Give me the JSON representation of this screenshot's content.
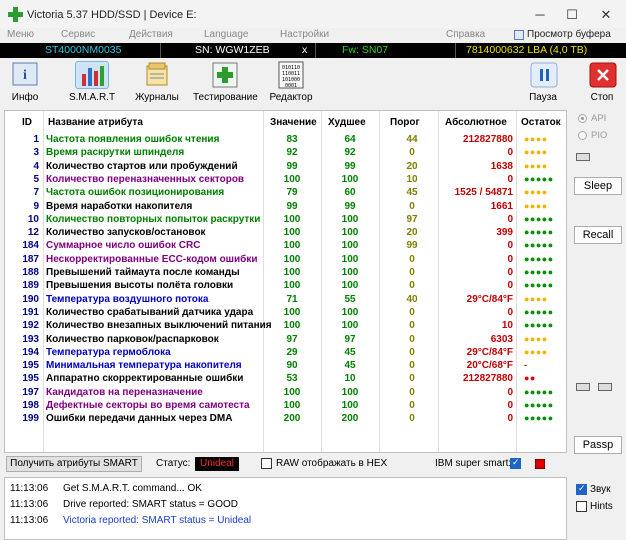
{
  "window": {
    "title": "Victoria 5.37 HDD/SSD | Device E:"
  },
  "menu": {
    "items": [
      "Меню",
      "Сервис",
      "Действия",
      "Language",
      "Настройки",
      "Справка"
    ],
    "preview_label": "Просмотр буфера"
  },
  "drive": {
    "model": "ST4000NM0035",
    "serial": "SN: WGW1ZEB",
    "close": "x",
    "firmware": "Fw: SN07",
    "capacity": "7814000632 LBA (4,0 TB)"
  },
  "toolbar": {
    "info": "Инфо",
    "smart": "S.M.A.R.T",
    "journals": "Журналы",
    "testing": "Тестирование",
    "editor": "Редактор",
    "pause": "Пауза",
    "stop": "Стоп"
  },
  "table": {
    "headers": [
      "ID",
      "Название атрибута",
      "Значение",
      "Худшее",
      "Порог",
      "Абсолютное",
      "Остаток"
    ],
    "rows": [
      {
        "id": "1",
        "name": "Частота появления ошибок чтения",
        "color": "#008000",
        "value": "83",
        "worst": "64",
        "threshold": "44",
        "raw": "212827880",
        "rest": "●●●●",
        "rest_color": "#f0b400"
      },
      {
        "id": "3",
        "name": "Время раскрутки шпинделя",
        "color": "#008000",
        "value": "92",
        "worst": "92",
        "threshold": "0",
        "raw": "0",
        "rest": "●●●●",
        "rest_color": "#f0b400"
      },
      {
        "id": "4",
        "name": "Количество стартов или пробуждений",
        "color": "#000000",
        "value": "99",
        "worst": "99",
        "threshold": "20",
        "raw": "1638",
        "rest": "●●●●",
        "rest_color": "#f0b400"
      },
      {
        "id": "5",
        "name": "Количество переназначенных секторов",
        "color": "#800080",
        "value": "100",
        "worst": "100",
        "threshold": "10",
        "raw": "0",
        "rest": "●●●●●",
        "rest_color": "#009000"
      },
      {
        "id": "7",
        "name": "Частота ошибок позиционирования",
        "color": "#008000",
        "value": "79",
        "worst": "60",
        "threshold": "45",
        "raw": "1525 / 54871",
        "rest": "●●●●",
        "rest_color": "#f0b400"
      },
      {
        "id": "9",
        "name": "Время наработки накопителя",
        "color": "#000000",
        "value": "99",
        "worst": "99",
        "threshold": "0",
        "raw": "1661",
        "rest": "●●●●",
        "rest_color": "#f0b400"
      },
      {
        "id": "10",
        "name": "Количество повторных попыток раскрутки",
        "color": "#008000",
        "value": "100",
        "worst": "100",
        "threshold": "97",
        "raw": "0",
        "rest": "●●●●●",
        "rest_color": "#009000"
      },
      {
        "id": "12",
        "name": "Количество запусков/остановок",
        "color": "#000000",
        "value": "100",
        "worst": "100",
        "threshold": "20",
        "raw": "399",
        "rest": "●●●●●",
        "rest_color": "#009000"
      },
      {
        "id": "184",
        "name": "Суммарное число ошибок CRC",
        "color": "#800080",
        "value": "100",
        "worst": "100",
        "threshold": "99",
        "raw": "0",
        "rest": "●●●●●",
        "rest_color": "#009000"
      },
      {
        "id": "187",
        "name": "Нескорректированные ECC-кодом ошибки",
        "color": "#800080",
        "value": "100",
        "worst": "100",
        "threshold": "0",
        "raw": "0",
        "rest": "●●●●●",
        "rest_color": "#009000"
      },
      {
        "id": "188",
        "name": "Превышений таймаута после команды",
        "color": "#000000",
        "value": "100",
        "worst": "100",
        "threshold": "0",
        "raw": "0",
        "rest": "●●●●●",
        "rest_color": "#009000"
      },
      {
        "id": "189",
        "name": "Превышения высоты полёта головки",
        "color": "#000000",
        "value": "100",
        "worst": "100",
        "threshold": "0",
        "raw": "0",
        "rest": "●●●●●",
        "rest_color": "#009000"
      },
      {
        "id": "190",
        "name": "Температура воздушного потока",
        "color": "#0000c0",
        "value": "71",
        "worst": "55",
        "threshold": "40",
        "raw": "29°C/84°F",
        "rest": "●●●●",
        "rest_color": "#f0b400"
      },
      {
        "id": "191",
        "name": "Количество срабатываний датчика удара",
        "color": "#000000",
        "value": "100",
        "worst": "100",
        "threshold": "0",
        "raw": "0",
        "rest": "●●●●●",
        "rest_color": "#009000"
      },
      {
        "id": "192",
        "name": "Количество внезапных выключений питания",
        "color": "#000000",
        "value": "100",
        "worst": "100",
        "threshold": "0",
        "raw": "10",
        "rest": "●●●●●",
        "rest_color": "#009000"
      },
      {
        "id": "193",
        "name": "Количество парковок/распарковок",
        "color": "#000000",
        "value": "97",
        "worst": "97",
        "threshold": "0",
        "raw": "6303",
        "rest": "●●●●",
        "rest_color": "#f0b400"
      },
      {
        "id": "194",
        "name": "Температура гермоблока",
        "color": "#0000c0",
        "value": "29",
        "worst": "45",
        "threshold": "0",
        "raw": "29°C/84°F",
        "rest": "●●●●",
        "rest_color": "#f0b400"
      },
      {
        "id": "195",
        "name": "Минимальная температура накопителя",
        "color": "#0000c0",
        "value": "90",
        "worst": "45",
        "threshold": "0",
        "raw": "20°C/68°F",
        "rest": "-",
        "rest_color": "#c00000"
      },
      {
        "id": "195",
        "name": "Аппаратно скорректированные ошибки",
        "color": "#000000",
        "value": "53",
        "worst": "10",
        "threshold": "0",
        "raw": "212827880",
        "rest": "●●",
        "rest_color": "#e00000"
      },
      {
        "id": "197",
        "name": "Кандидатов на переназначение",
        "color": "#800080",
        "value": "100",
        "worst": "100",
        "threshold": "0",
        "raw": "0",
        "rest": "●●●●●",
        "rest_color": "#009000"
      },
      {
        "id": "198",
        "name": "Дефектные секторы во время самотеста",
        "color": "#800080",
        "value": "100",
        "worst": "100",
        "threshold": "0",
        "raw": "0",
        "rest": "●●●●●",
        "rest_color": "#009000"
      },
      {
        "id": "199",
        "name": "Ошибки передачи данных через DMA",
        "color": "#000000",
        "value": "200",
        "worst": "200",
        "threshold": "0",
        "raw": "0",
        "rest": "●●●●●",
        "rest_color": "#009000"
      }
    ]
  },
  "statusbar": {
    "get_button": "Получить атрибуты SMART",
    "status_label": "Статус:",
    "status_value": "Unideal",
    "raw_hex_label": "RAW отображать в HEX",
    "raw_hex_checked": false,
    "ibm_label": "IBM super smart:",
    "ibm_checked": true
  },
  "log": [
    {
      "time": "11:13:06",
      "text": "Get S.M.A.R.T. command... OK",
      "style": "normal"
    },
    {
      "time": "11:13:06",
      "text": "Drive reported: SMART status = GOOD",
      "style": "normal"
    },
    {
      "time": "11:13:06",
      "text": "Victoria reported: SMART status = Unideal",
      "style": "blue"
    }
  ],
  "right_panel": {
    "api_label": "API",
    "pio_label": "PIO",
    "sleep": "Sleep",
    "recall": "Recall",
    "passp": "Passp",
    "sound_label": "Звук",
    "sound_checked": true,
    "hints_label": "Hints",
    "hints_checked": false
  },
  "colors": {
    "drive_bar_bg": "#000000",
    "status_badge_text": "#ff3030",
    "log_blue": "#1a3ccc"
  }
}
